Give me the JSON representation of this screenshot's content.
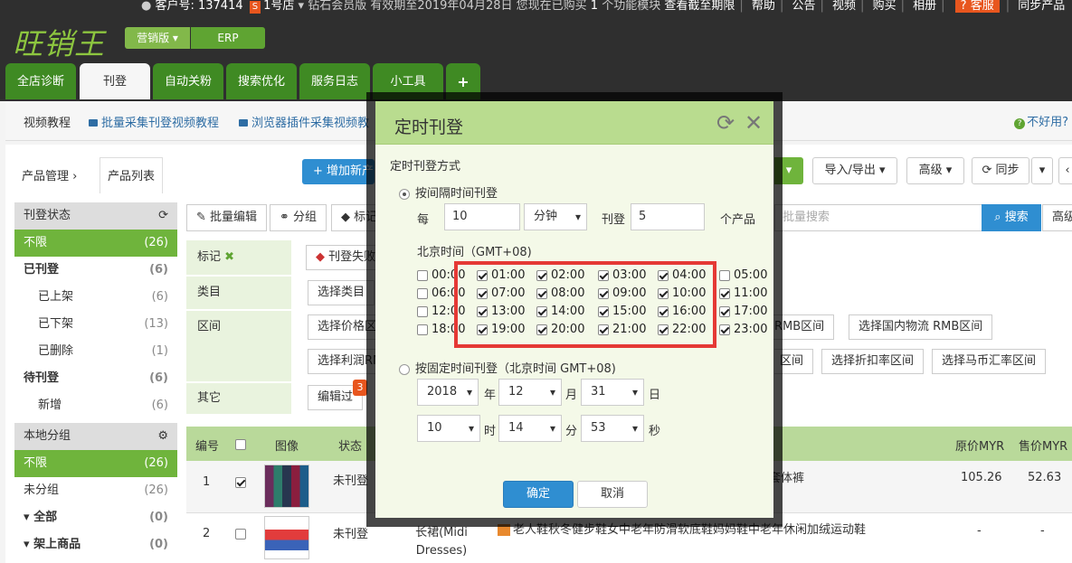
{
  "top": {
    "logo_main": "旺销王",
    "edition": "营销版",
    "erp": "ERP",
    "customer": "客户号: 137414",
    "shop_tag": "S",
    "shop": "1号店",
    "membership": "钻石会员版 有效期至2019年04月28日 您现在已购买",
    "module_count": "1",
    "module_text": "个功能模块",
    "view_expiry": "查看截至期限",
    "links": [
      "帮助",
      "公告",
      "视频",
      "购买",
      "相册"
    ],
    "service": "客服",
    "sync_products": "同步产品"
  },
  "tabs": [
    "全店诊断",
    "刊登",
    "自动关粉",
    "搜索优化",
    "服务日志",
    "小工具",
    "+"
  ],
  "subnav": {
    "video_tutorial": "视频教程",
    "link1": "批量采集刊登视频教程",
    "link2": "浏览器插件采集视频教",
    "help": "不好用?"
  },
  "breadcrumb": {
    "parent": "产品管理",
    "current": "产品列表"
  },
  "actions": {
    "add": "增加新产",
    "import_export": "导入/导出",
    "advanced": "高级",
    "sync": "同步",
    "batch_edit": "批量编辑",
    "group": "分组",
    "tag": "标记",
    "search_placeholder": "批量搜索",
    "search": "搜索",
    "adv_short": "高级"
  },
  "sidebar": {
    "status_head": "刊登状态",
    "items": [
      {
        "label": "不限",
        "count": "(26)"
      },
      {
        "label": "已刊登",
        "count": "(6)"
      },
      {
        "label": "已上架",
        "count": "(6)"
      },
      {
        "label": "已下架",
        "count": "(13)"
      },
      {
        "label": "已删除",
        "count": "(1)"
      },
      {
        "label": "待刊登",
        "count": "(6)"
      },
      {
        "label": "新增",
        "count": "(6)"
      }
    ],
    "group_head": "本地分组",
    "groups": [
      {
        "label": "不限",
        "count": "(26)"
      },
      {
        "label": "未分组",
        "count": "(26)"
      },
      {
        "label": "全部",
        "count": "(0)"
      },
      {
        "label": "架上商品",
        "count": "(0)"
      }
    ]
  },
  "filters": {
    "tag_label": "标记",
    "tag_pill": "刊登失败",
    "category_label": "类目",
    "category_pill": "选择类目",
    "range_label": "区间",
    "range_pills": [
      "选择价格区",
      "RMB区间",
      "选择国内物流 RMB区间",
      "选择利润RM",
      "区间",
      "选择折扣率区间",
      "选择马币汇率区间"
    ],
    "other_label": "其它",
    "other_pill": "编辑过",
    "other_badge": "3"
  },
  "table": {
    "headers": [
      "编号",
      "图像",
      "状态",
      "原价MYR",
      "售价MYR"
    ],
    "rows": [
      {
        "id": "1",
        "status": "未刊登",
        "title": "套体裤",
        "orig": "105.26",
        "sale": "52.63",
        "checked": true
      },
      {
        "id": "2",
        "status": "未刊登",
        "category": "长裙(Midi Dresses)",
        "title": "老人鞋秋冬健步鞋女中老年防滑软底鞋妈妈鞋中老年休闲加绒运动鞋",
        "orig": "-",
        "sale": "-",
        "checked": false
      }
    ]
  },
  "modal": {
    "title": "定时刊登",
    "method_label": "定时刊登方式",
    "interval_option": "按间隔时间刊登",
    "every": "每",
    "interval_value": "10",
    "unit": "分钟",
    "publish": "刊登",
    "count_value": "5",
    "per_products": "个产品",
    "timezone_label": "北京时间（GMT+08)",
    "hours": [
      {
        "label": "00:00",
        "checked": false
      },
      {
        "label": "01:00",
        "checked": true
      },
      {
        "label": "02:00",
        "checked": true
      },
      {
        "label": "03:00",
        "checked": true
      },
      {
        "label": "04:00",
        "checked": true
      },
      {
        "label": "05:00",
        "checked": false
      },
      {
        "label": "06:00",
        "checked": false
      },
      {
        "label": "07:00",
        "checked": true
      },
      {
        "label": "08:00",
        "checked": true
      },
      {
        "label": "09:00",
        "checked": true
      },
      {
        "label": "10:00",
        "checked": true
      },
      {
        "label": "11:00",
        "checked": true
      },
      {
        "label": "12:00",
        "checked": false
      },
      {
        "label": "13:00",
        "checked": true
      },
      {
        "label": "14:00",
        "checked": true
      },
      {
        "label": "15:00",
        "checked": true
      },
      {
        "label": "16:00",
        "checked": true
      },
      {
        "label": "17:00",
        "checked": true
      },
      {
        "label": "18:00",
        "checked": false
      },
      {
        "label": "19:00",
        "checked": true
      },
      {
        "label": "20:00",
        "checked": true
      },
      {
        "label": "21:00",
        "checked": true
      },
      {
        "label": "22:00",
        "checked": true
      },
      {
        "label": "23:00",
        "checked": true
      }
    ],
    "fixed_option": "按固定时间刊登（北京时间 GMT+08)",
    "year": "2018",
    "year_unit": "年",
    "month": "12",
    "month_unit": "月",
    "day": "31",
    "day_unit": "日",
    "hour": "10",
    "hour_unit": "时",
    "minute": "14",
    "minute_unit": "分",
    "second": "53",
    "second_unit": "秒",
    "confirm": "确定",
    "cancel": "取消"
  }
}
